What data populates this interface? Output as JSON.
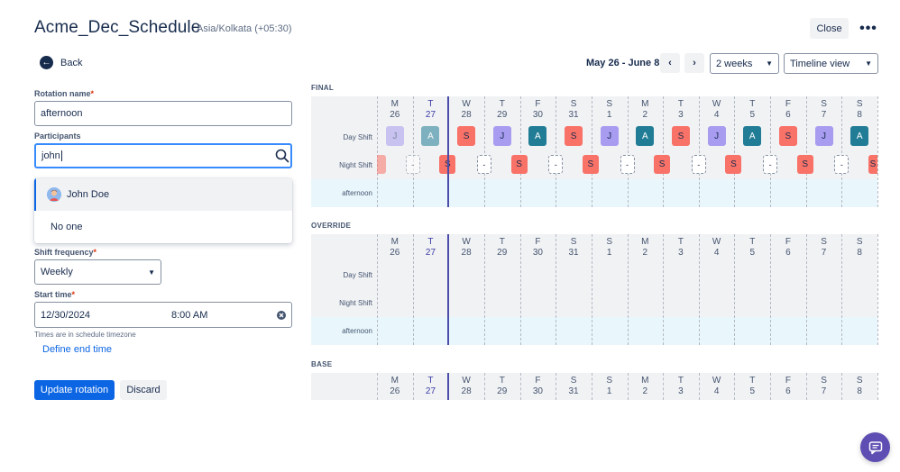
{
  "header": {
    "title": "Acme_Dec_Schedule",
    "timezone": "Asia/Kolkata (+05:30)",
    "close_label": "Close",
    "more_icon": "more-horizontal-icon"
  },
  "back_label": "Back",
  "form": {
    "rotation_name_label": "Rotation name",
    "rotation_name_value": "afternoon",
    "participants_label": "Participants",
    "participants_value": "john",
    "dropdown": [
      {
        "label": "John Doe",
        "avatar": true
      },
      {
        "label": "No one",
        "avatar": false
      }
    ],
    "shift_frequency_label": "Shift frequency",
    "shift_frequency_value": "Weekly",
    "start_time_label": "Start time",
    "start_date_value": "12/30/2024",
    "start_time_value": "8:00 AM",
    "timezone_hint": "Times are in schedule timezone",
    "define_end_time": "Define end time",
    "update_label": "Update rotation",
    "discard_label": "Discard",
    "required_mark": "*"
  },
  "toolbar": {
    "date_range": "May 26 - June 8",
    "prev_icon": "chevron-left-icon",
    "next_icon": "chevron-right-icon",
    "weeks_value": "2 weeks",
    "view_value": "Timeline view"
  },
  "timeline": {
    "days": [
      {
        "dow": "M",
        "date": "26",
        "today": false
      },
      {
        "dow": "T",
        "date": "27",
        "today": true
      },
      {
        "dow": "W",
        "date": "28",
        "today": false
      },
      {
        "dow": "T",
        "date": "29",
        "today": false
      },
      {
        "dow": "F",
        "date": "30",
        "today": false
      },
      {
        "dow": "S",
        "date": "31",
        "today": false
      },
      {
        "dow": "S",
        "date": "1",
        "today": false
      },
      {
        "dow": "M",
        "date": "2",
        "today": false
      },
      {
        "dow": "T",
        "date": "3",
        "today": false
      },
      {
        "dow": "W",
        "date": "4",
        "today": false
      },
      {
        "dow": "T",
        "date": "5",
        "today": false
      },
      {
        "dow": "F",
        "date": "6",
        "today": false
      },
      {
        "dow": "S",
        "date": "7",
        "today": false
      },
      {
        "dow": "S",
        "date": "8",
        "today": false
      }
    ],
    "sections": [
      {
        "title": "FINAL",
        "rows": [
          "Day Shift",
          "Night Shift",
          "afternoon"
        ],
        "blocks": true
      },
      {
        "title": "OVERRIDE",
        "rows": [
          "Day Shift",
          "Night Shift",
          "afternoon"
        ],
        "blocks": false
      },
      {
        "title": "BASE",
        "rows": [],
        "blocks": false
      }
    ],
    "day_shift": [
      "J",
      "A",
      "S",
      "J",
      "A",
      "S",
      "J",
      "A",
      "S",
      "J",
      "A",
      "S",
      "J",
      "A"
    ],
    "night_shift": [
      "",
      "-",
      "S",
      "-",
      "S",
      "-",
      "S",
      "-",
      "S",
      "-",
      "S",
      "-",
      "S",
      "-",
      "S"
    ],
    "colors": {
      "J": "#a79cf0",
      "A": "#217d95",
      "S": "#f87268",
      "dash_bg": "#ffffff",
      "today_line": "#4c4cab",
      "grid_bg": "#f1f2f4",
      "afternoon_bg": "#e9f7fc"
    }
  }
}
